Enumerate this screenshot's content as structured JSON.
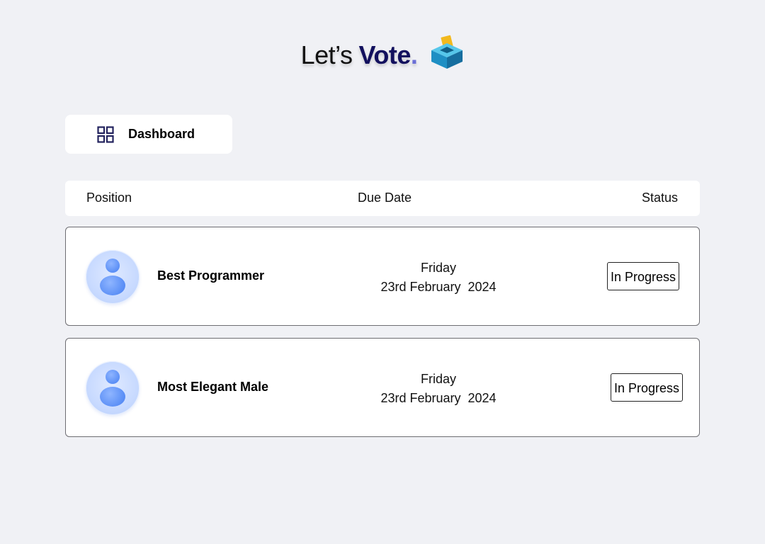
{
  "header": {
    "title_part1": "Let’s",
    "title_part2": "Vote",
    "title_dot": ".",
    "icon": "ballot-box-icon",
    "colors": {
      "vote": "#12105e",
      "dot": "#6b6fd6"
    }
  },
  "nav": {
    "dashboard_label": "Dashboard",
    "icon": "grid-icon"
  },
  "table": {
    "headers": {
      "position": "Position",
      "due_date": "Due Date",
      "status": "Status"
    },
    "rows": [
      {
        "position": "Best Programmer",
        "due_day": "Friday",
        "due_date": "23rd February  2024",
        "status": "In Progress",
        "avatar_icon": "user-avatar-icon"
      },
      {
        "position": "Most Elegant Male",
        "due_day": "Friday",
        "due_date": "23rd February  2024",
        "status": "In Progress",
        "avatar_icon": "user-avatar-icon"
      }
    ]
  },
  "colors": {
    "background": "#f0f1f5",
    "card": "#ffffff",
    "avatar": "#5b8ff6"
  }
}
